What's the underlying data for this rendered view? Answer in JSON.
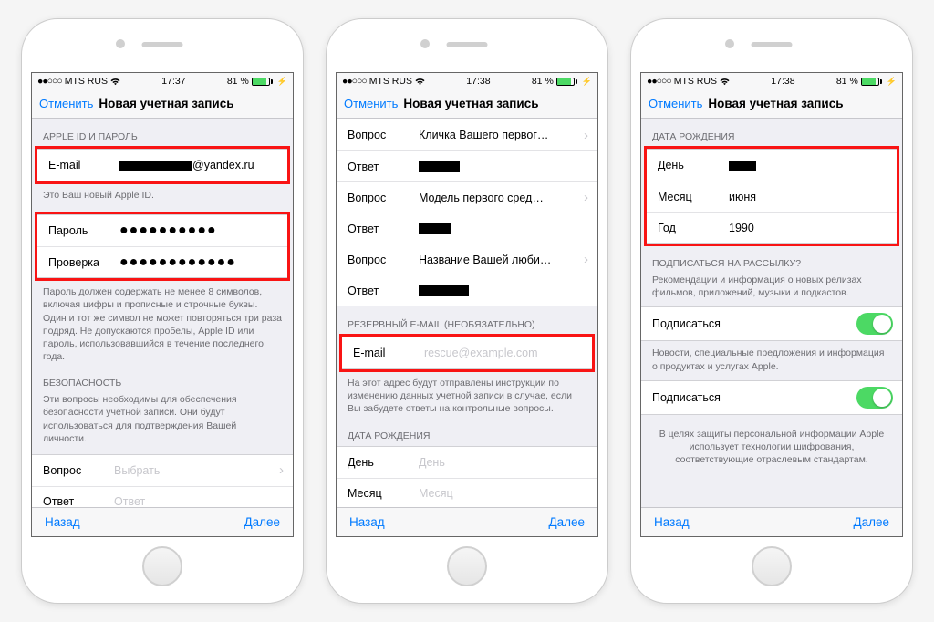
{
  "statusbar": {
    "carrier": "MTS RUS",
    "time1": "17:37",
    "time2": "17:38",
    "time3": "17:38",
    "battery_pct": "81 %"
  },
  "nav": {
    "cancel": "Отменить",
    "title": "Новая учетная запись"
  },
  "bottom": {
    "back": "Назад",
    "next": "Далее"
  },
  "phone1": {
    "section_appleid": "APPLE ID И ПАРОЛЬ",
    "email_label": "E-mail",
    "email_suffix": "@yandex.ru",
    "footer_appleid": "Это Ваш новый Apple ID.",
    "password_label": "Пароль",
    "password_value": "●●●●●●●●●●",
    "verify_label": "Проверка",
    "verify_value": "●●●●●●●●●●●●",
    "footer_password": "Пароль должен содержать не менее 8 символов, включая цифры и прописные и строчные буквы. Один и тот же символ не может повторяться три раза подряд. Не допускаются пробелы, Apple ID или пароль, использовавшийся в течение последнего года.",
    "section_security": "БЕЗОПАСНОСТЬ",
    "footer_security": "Эти вопросы необходимы для обеспечения безопасности учетной записи. Они будут использоваться для подтверждения Вашей личности.",
    "question_label": "Вопрос",
    "question_placeholder": "Выбрать",
    "answer_label": "Ответ",
    "answer_placeholder": "Ответ"
  },
  "phone2": {
    "question_label": "Вопрос",
    "answer_label": "Ответ",
    "q1": "Кличка Вашего первог…",
    "q2": "Модель первого сред…",
    "q3": "Название Вашей люби…",
    "section_backup": "РЕЗЕРВНЫЙ E-MAIL (НЕОБЯЗАТЕЛЬНО)",
    "backup_email_label": "E-mail",
    "backup_email_placeholder": "rescue@example.com",
    "footer_backup": "На этот адрес будут отправлены инструкции по изменению данных учетной записи в случае, если Вы забудете ответы на контрольные вопросы.",
    "section_dob": "ДАТА РОЖДЕНИЯ",
    "day_label": "День",
    "day_placeholder": "День",
    "month_label": "Месяц",
    "month_placeholder": "Месяц"
  },
  "phone3": {
    "section_dob": "ДАТА РОЖДЕНИЯ",
    "day_label": "День",
    "month_label": "Месяц",
    "month_value": "июня",
    "year_label": "Год",
    "year_value": "1990",
    "section_subscribe": "ПОДПИСАТЬСЯ НА РАССЫЛКУ?",
    "footer_sub1": "Рекомендации и информация о новых релизах фильмов, приложений, музыки и подкастов.",
    "subscribe_label": "Подписаться",
    "footer_sub2": "Новости, специальные предложения и информация о продуктах и услугах Apple.",
    "footer_privacy": "В целях защиты персональной информации Apple использует технологии шифрования, соответствующие отраслевым стандартам."
  }
}
